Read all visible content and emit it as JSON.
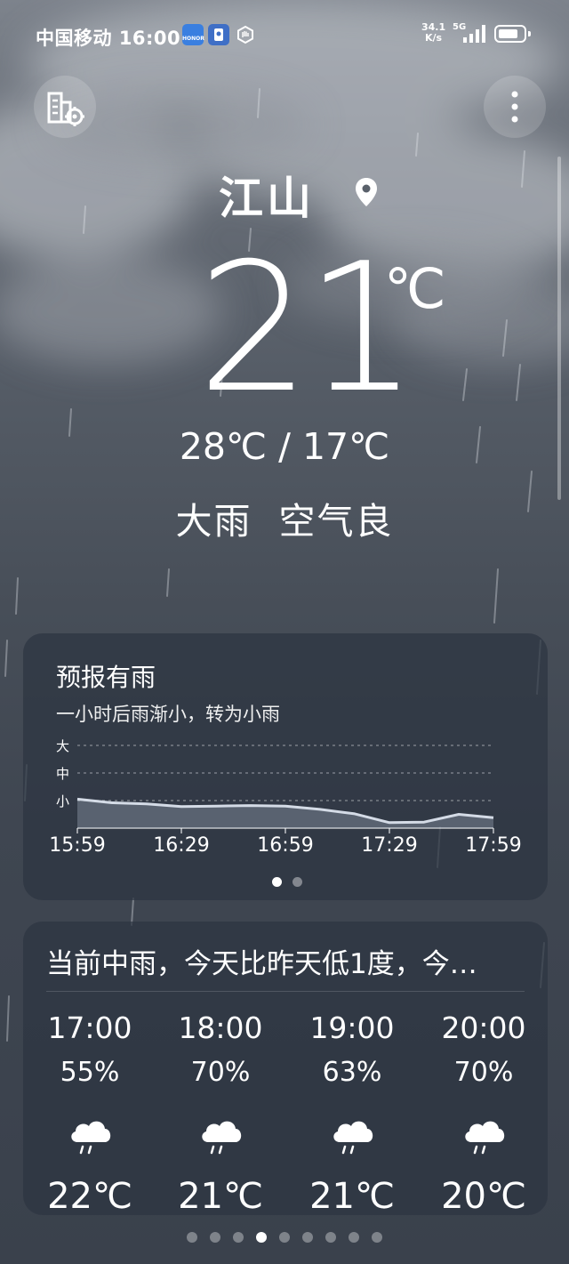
{
  "status_bar": {
    "carrier": "中国移动",
    "time": "16:00",
    "app_icon_1": "HONOR",
    "net_speed_value": "34.1",
    "net_speed_unit": "K/s",
    "network": "5G",
    "battery_level": 0.8
  },
  "header": {
    "left_button_icon": "city-manage-icon",
    "menu_icon": "more-vert-icon",
    "city": "江山",
    "location_icon": "location-pin-icon",
    "temperature": "21",
    "temperature_unit": "℃",
    "range": "28℃ / 17℃",
    "condition": "大雨  空气良"
  },
  "precip_card": {
    "title": "预报有雨",
    "subtitle": "一小时后雨渐小，转为小雨",
    "intensity_levels": [
      "大",
      "中",
      "小"
    ],
    "time_labels": [
      "15:59",
      "16:29",
      "16:59",
      "17:29",
      "17:59"
    ],
    "page_dots": 2,
    "active_page": 0
  },
  "chart_data": {
    "type": "area",
    "title": "",
    "x": [
      "15:59",
      "16:09",
      "16:19",
      "16:29",
      "16:39",
      "16:49",
      "16:59",
      "17:09",
      "17:19",
      "17:29",
      "17:39",
      "17:49",
      "17:59"
    ],
    "y_scale_labels": [
      "小",
      "中",
      "大"
    ],
    "ylim": [
      0,
      3
    ],
    "values": [
      1.05,
      0.92,
      0.88,
      0.78,
      0.8,
      0.82,
      0.8,
      0.68,
      0.52,
      0.2,
      0.22,
      0.5,
      0.38
    ],
    "grid": true
  },
  "hourly_card": {
    "summary": "当前中雨，今天比昨天低1度，今…",
    "hours": [
      {
        "time": "17:00",
        "pop": "55%",
        "icon": "rain-cloud-icon",
        "temp": "22℃"
      },
      {
        "time": "18:00",
        "pop": "70%",
        "icon": "rain-cloud-icon",
        "temp": "21℃"
      },
      {
        "time": "19:00",
        "pop": "63%",
        "icon": "rain-cloud-icon",
        "temp": "21℃"
      },
      {
        "time": "20:00",
        "pop": "70%",
        "icon": "rain-cloud-icon",
        "temp": "20℃"
      }
    ]
  },
  "pager": {
    "count": 9,
    "active": 3
  },
  "colors": {
    "accent": "#ffffff",
    "card": "#2d3541"
  }
}
